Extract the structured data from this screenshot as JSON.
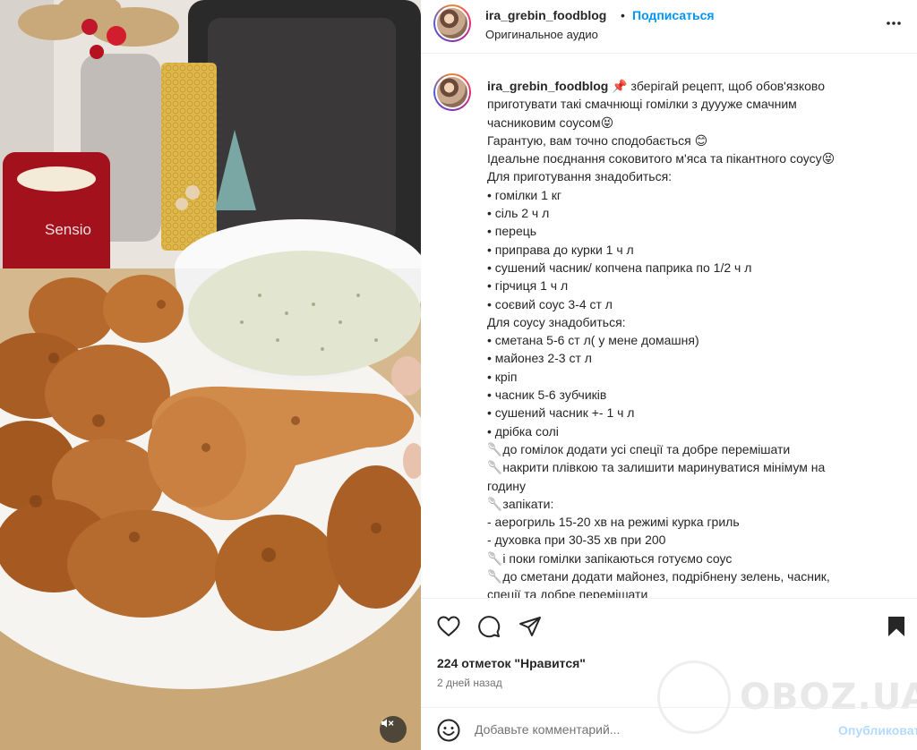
{
  "header": {
    "username": "ira_grebin_foodblog",
    "separator": "•",
    "follow_label": "Подписаться",
    "audio": "Оригинальное аудио"
  },
  "media": {
    "candle_brand": "Sensio"
  },
  "caption": {
    "username": "ira_grebin_foodblog",
    "lines": [
      "📌 зберігай рецепт, щоб обов'язково",
      "приготувати такі смачнющі гомілки з дуууже смачним",
      "часниковим соусом😝",
      "Гарантую, вам точно сподобається 😊",
      "Ідеальне поєднання соковитого м'яса та пікантного соусу😝",
      "Для приготування знадобиться:",
      "• гомілки 1 кг",
      "• сіль 2 ч л",
      "• перець",
      "• приправа до курки 1 ч л",
      "• сушений часник/ копчена паприка по 1/2 ч л",
      "• гірчиця 1 ч л",
      "• соєвий соус 3-4 ст л",
      "Для соусу знадобиться:",
      "• сметана 5-6 ст л( у мене домашня)",
      "• майонез 2-3 ст л",
      "• кріп",
      "• часник 5-6 зубчиків",
      "• сушений часник +- 1 ч л",
      "• дрібка солі",
      "🥄до гомілок додати усі спеції та добре перемішати",
      "🥄накрити плівкою та залишити маринуватися мінімум на",
      "годину",
      "🥄запікати:",
      "- аерогриль 15-20 хв на режимі курка гриль",
      "- духовка при 30-35 хв при 200",
      "🥄і поки гомілки запікаються готуємо соус",
      "🥄до сметани додати майонез, подрібнену зелень, часник,",
      "спеції та добре перемішати"
    ]
  },
  "stats": {
    "likes": "224 отметок \"Нравится\"",
    "date": "2 дней назад"
  },
  "comment": {
    "placeholder": "Добавьте комментарий...",
    "post_label": "Опубликовать"
  },
  "watermark": {
    "text": "OBOZ.UA"
  },
  "icons": {
    "more": "more-icon",
    "like": "heart-icon",
    "comment": "comment-icon",
    "share": "share-icon",
    "save": "bookmark-icon",
    "emoji": "emoji-icon",
    "mute": "muted-speaker-icon"
  },
  "colors": {
    "link": "#0095f6",
    "post_disabled": "#b3dbff",
    "text": "#262626",
    "muted": "#737373"
  }
}
